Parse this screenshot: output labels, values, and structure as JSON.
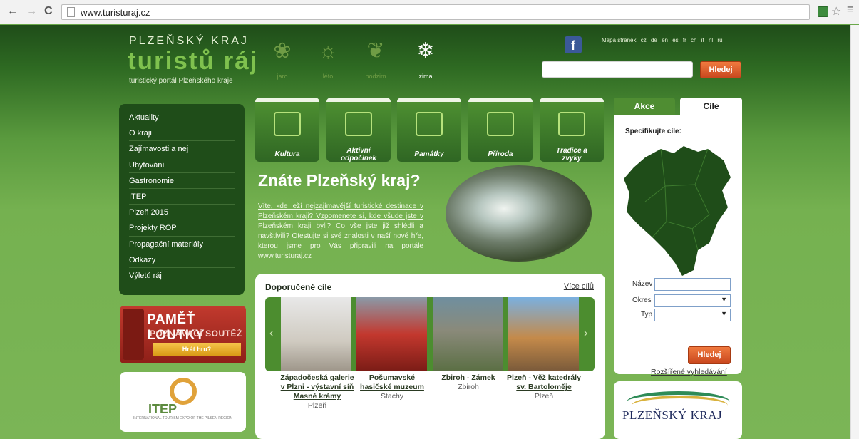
{
  "browser": {
    "url": "www.turisturaj.cz"
  },
  "header": {
    "region": "PLZEŇSKÝ KRAJ",
    "brand": "turistů ráj",
    "tagline": "turistický portál Plzeňského kraje",
    "seasons": [
      {
        "label": "jaro",
        "icon": "flower-icon"
      },
      {
        "label": "léto",
        "icon": "sun-icon"
      },
      {
        "label": "podzim",
        "icon": "leaf-icon"
      },
      {
        "label": "zima",
        "icon": "snowflake-icon"
      }
    ],
    "toplinks": [
      "Mapa stránek",
      "cz",
      "de",
      "en",
      "es",
      "fr",
      "ch",
      "it",
      "nl",
      "ru"
    ],
    "search_button": "Hledej"
  },
  "sidebar": {
    "items": [
      "Aktuality",
      "O kraji",
      "Zajímavosti a nej",
      "Ubytování",
      "Gastronomie",
      "ITEP",
      "Plzeň 2015",
      "Projekty ROP",
      "Propagační materiály",
      "Odkazy",
      "Výletů ráj"
    ]
  },
  "promo": {
    "title": "PAMĚŤ LOUTKY",
    "subtitle": "POZNÁVACÍ SOUTĚŽ",
    "button": "Hrát hru?"
  },
  "itep": {
    "logo": "ITEP",
    "small": "INTERNATIONAL TOURISM EXPO OF THE PILSEN REGION"
  },
  "categories": [
    {
      "label": "Kultura"
    },
    {
      "label": "Aktivní odpočinek"
    },
    {
      "label": "Památky"
    },
    {
      "label": "Příroda"
    },
    {
      "label": "Tradice a zvyky"
    }
  ],
  "hero": {
    "title": "Znáte Plzeňský kraj?",
    "text": "Víte, kde leží nejzajímavější turistické destinace v Plzeňském kraji? Vzpomenete si, kde všude jste v Plzeňském kraji byli? Co vše jste již shlédli a navštívili? Otestujte si své znalosti v naší nové hře, kterou jsme pro Vás připravili na portále www.turisturaj.cz"
  },
  "recommended": {
    "title": "Doporučené cíle",
    "more": "Více cílů",
    "items": [
      {
        "name": "Západočeská galerie v Plzni - výstavní síň Masné krámy",
        "place": "Plzeň"
      },
      {
        "name": "Pošumavské hasičské muzeum",
        "place": "Stachy"
      },
      {
        "name": "Zbiroh - Zámek",
        "place": "Zbiroh"
      },
      {
        "name": "Plzeň - Věž katedrály sv. Bartoloměje",
        "place": "Plzeň"
      }
    ]
  },
  "panel": {
    "tab_akce": "Akce",
    "tab_cile": "Cíle",
    "spec": "Specifikujte cíle:",
    "label_nazev": "Název",
    "label_okres": "Okres",
    "label_typ": "Typ",
    "button": "Hledej",
    "advanced": "Rozšířené vyhledávání"
  },
  "plzensky_logo": "PLZEŇSKÝ KRAJ"
}
